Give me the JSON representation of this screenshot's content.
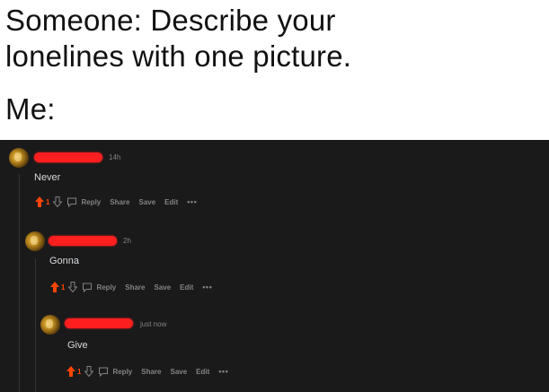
{
  "caption": {
    "line1": "Someone: Describe your",
    "line2": "lonelines with one picture.",
    "line3": "Me:"
  },
  "colors": {
    "background": "#1a1a1b",
    "upvote": "#ff4500",
    "redaction": "#ff1f1f",
    "text": "#d7dadc",
    "muted": "#818384"
  },
  "comments": [
    {
      "time": "14h",
      "body": "Never",
      "votes": "1",
      "actions": {
        "reply": "Reply",
        "share": "Share",
        "save": "Save",
        "edit": "Edit",
        "more": "•••"
      }
    },
    {
      "time": "2h",
      "body": "Gonna",
      "votes": "1",
      "actions": {
        "reply": "Reply",
        "share": "Share",
        "save": "Save",
        "edit": "Edit",
        "more": "•••"
      }
    },
    {
      "time": "just now",
      "body": "Give",
      "votes": "1",
      "actions": {
        "reply": "Reply",
        "share": "Share",
        "save": "Save",
        "edit": "Edit",
        "more": "•••"
      }
    }
  ]
}
